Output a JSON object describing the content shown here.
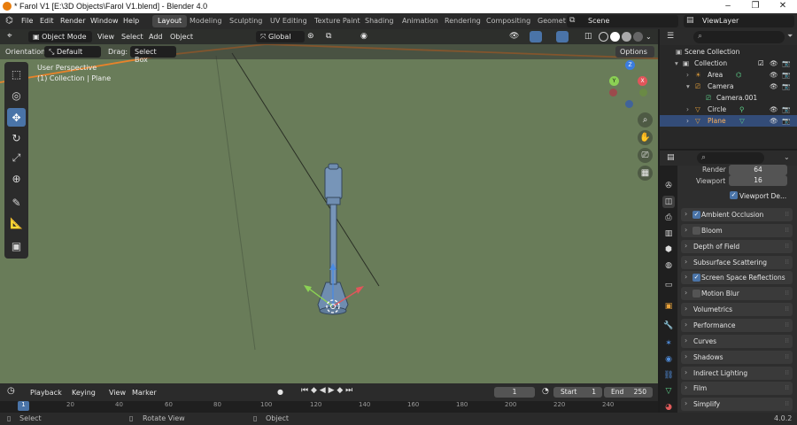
{
  "window": {
    "title": "* Farol V1 [E:\\3D Objects\\Farol V1.blend] - Blender 4.0",
    "minimize": "–",
    "maximize": "❐",
    "close": "✕"
  },
  "menu": [
    "File",
    "Edit",
    "Render",
    "Window",
    "Help"
  ],
  "workspaces": [
    "Layout",
    "Modeling",
    "Sculpting",
    "UV Editing",
    "Texture Paint",
    "Shading",
    "Animation",
    "Rendering",
    "Compositing",
    "Geomet"
  ],
  "scene_name": "Scene",
  "view_layer": "ViewLayer",
  "viewport_header": {
    "mode": "Object Mode",
    "menus": [
      "View",
      "Select",
      "Add",
      "Object"
    ],
    "transform_orientation": "Global",
    "options": "Options"
  },
  "tool_settings": {
    "orientation_label": "Orientation:",
    "orientation_value": "Default",
    "drag_label": "Drag:",
    "drag_value": "Select Box"
  },
  "viewport_overlay": {
    "view_name": "User Perspective",
    "collection_info": "(1) Collection | Plane"
  },
  "gizmo": {
    "x": "X",
    "y": "Y",
    "z": "Z"
  },
  "outliner": {
    "scene_collection": "Scene Collection",
    "items": [
      {
        "label": "Collection"
      },
      {
        "label": "Area"
      },
      {
        "label": "Camera"
      },
      {
        "label": "Camera.001"
      },
      {
        "label": "Circle"
      },
      {
        "label": "Plane"
      }
    ]
  },
  "properties": {
    "render_label": "Render",
    "render_value": "64",
    "viewport_label": "Viewport",
    "viewport_value": "16",
    "viewport_denoise": "Viewport De...",
    "panels": [
      {
        "label": "Ambient Occlusion",
        "checkbox": true,
        "checked": true
      },
      {
        "label": "Bloom",
        "checkbox": true,
        "checked": false
      },
      {
        "label": "Depth of Field",
        "checkbox": false
      },
      {
        "label": "Subsurface Scattering",
        "checkbox": false
      },
      {
        "label": "Screen Space Reflections",
        "checkbox": true,
        "checked": true
      },
      {
        "label": "Motion Blur",
        "checkbox": true,
        "checked": false
      },
      {
        "label": "Volumetrics",
        "checkbox": false
      },
      {
        "label": "Performance",
        "checkbox": false
      },
      {
        "label": "Curves",
        "checkbox": false
      },
      {
        "label": "Shadows",
        "checkbox": false
      },
      {
        "label": "Indirect Lighting",
        "checkbox": false
      },
      {
        "label": "Film",
        "checkbox": false
      },
      {
        "label": "Simplify",
        "checkbox": false
      }
    ]
  },
  "timeline": {
    "menus": [
      "Playback",
      "Keying",
      "View",
      "Marker"
    ],
    "current_frame": "1",
    "start_label": "Start",
    "start_value": "1",
    "end_label": "End",
    "end_value": "250",
    "ticks": [
      "1",
      "20",
      "40",
      "60",
      "80",
      "100",
      "120",
      "140",
      "160",
      "180",
      "200",
      "220",
      "240"
    ]
  },
  "statusbar": {
    "select": "Select",
    "rotate": "Rotate View",
    "object": "Object",
    "version": "4.0.2"
  },
  "colors": {
    "viewport_bg": "#697c59",
    "accent": "#4a74a8",
    "selection": "#334c78",
    "horizon": "#e8832a"
  }
}
